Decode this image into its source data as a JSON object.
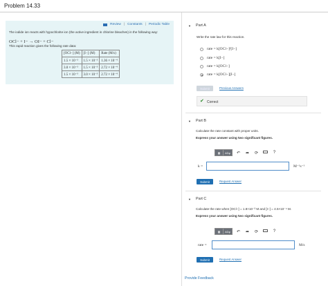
{
  "page": {
    "title": "Problem 14.33"
  },
  "left": {
    "links": [
      "Review",
      "Constants",
      "Periodic Table"
    ],
    "intro": "The iodide ion reacts with hypochlorite ion (the active ingredient in chlorine bleaches) in the following way:",
    "equation": "OCl− + I− → OI− + Cl−",
    "note": "This rapid reaction gives the following rate data:",
    "table": {
      "headers": [
        "[OCl−] (M)",
        "[I−] (M)",
        "Rate (M/s)"
      ],
      "rows": [
        [
          "1.5 × 10⁻³",
          "1.5 × 10⁻³",
          "1.36 × 10⁻⁴"
        ],
        [
          "3.0 × 10⁻³",
          "1.5 × 10⁻³",
          "2.72 × 10⁻⁴"
        ],
        [
          "1.5 × 10⁻³",
          "3.0 × 10⁻³",
          "2.72 × 10⁻⁴"
        ]
      ]
    }
  },
  "partA": {
    "title": "Part A",
    "prompt": "Write the rate law for this reaction.",
    "options": [
      "rate = k[OCl−]²[I−]",
      "rate = k[I−]",
      "rate = k[OCl−]",
      "rate = k[OCl−][I−]"
    ],
    "selected_index": 3,
    "submit": "Submit",
    "previous": "Previous Answers",
    "result": "Correct"
  },
  "partB": {
    "title": "Part B",
    "prompt": "Calculate the rate constant with proper units.",
    "instruction": "Express your answer using two significant figures.",
    "toolbar": {
      "sym": "AΣφ",
      "help": "?"
    },
    "var_label": "k =",
    "input_value": "",
    "units": "M⁻¹s⁻¹",
    "submit": "Submit",
    "request": "Request Answer"
  },
  "partC": {
    "title": "Part C",
    "prompt": "Calculate the rate when [OCl−] = 1.8×10⁻³ M and [I−] = 4.5×10⁻⁴ M.",
    "instruction": "Express your answer using two significant figures.",
    "toolbar": {
      "sym": "AΣφ",
      "help": "?"
    },
    "var_label": "rate =",
    "input_value": "",
    "units": "M/s",
    "submit": "Submit",
    "request": "Request Answer"
  },
  "footer": {
    "feedback": "Provide Feedback"
  }
}
